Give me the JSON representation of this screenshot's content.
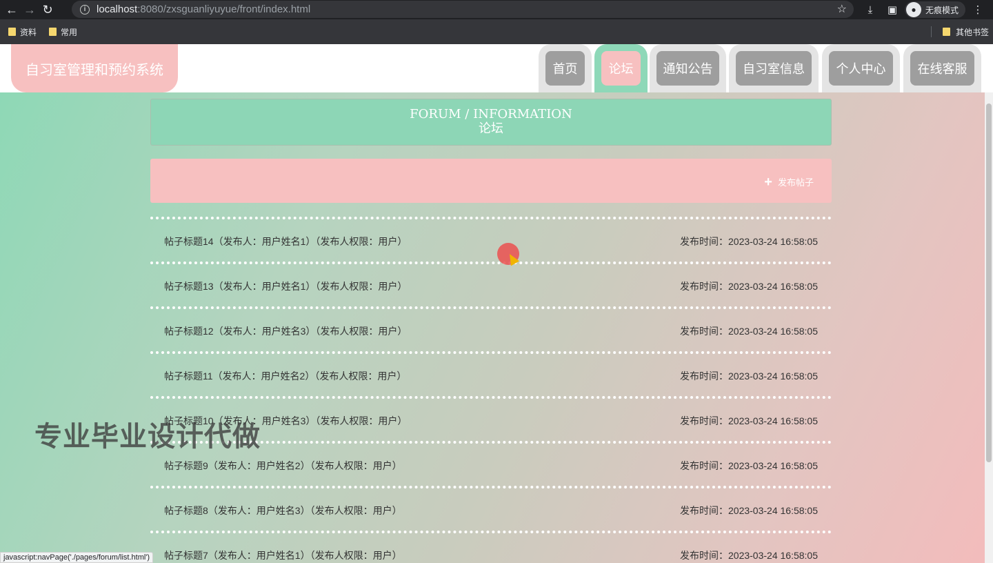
{
  "browser": {
    "url_host": "localhost",
    "url_rest": ":8080/zxsguanliyuyue/front/index.html",
    "incognito_label": "无痕模式",
    "bookmarks": [
      "资料",
      "常用"
    ],
    "other_bookmarks": "其他书签"
  },
  "site": {
    "logo": "自习室管理和预约系统",
    "nav": [
      "首页",
      "论坛",
      "通知公告",
      "自习室信息",
      "个人中心",
      "在线客服"
    ],
    "active_nav": "论坛"
  },
  "forum": {
    "title_en": "FORUM / INFORMATION",
    "title_cn": "论坛",
    "publish_label": "发布帖子",
    "posts": [
      {
        "title": "帖子标题14（发布人：用户姓名1）（发布人权限：用户）",
        "time": "发布时间：2023-03-24 16:58:05"
      },
      {
        "title": "帖子标题13（发布人：用户姓名1）（发布人权限：用户）",
        "time": "发布时间：2023-03-24 16:58:05"
      },
      {
        "title": "帖子标题12（发布人：用户姓名3）（发布人权限：用户）",
        "time": "发布时间：2023-03-24 16:58:05"
      },
      {
        "title": "帖子标题11（发布人：用户姓名2）（发布人权限：用户）",
        "time": "发布时间：2023-03-24 16:58:05"
      },
      {
        "title": "帖子标题10（发布人：用户姓名3）（发布人权限：用户）",
        "time": "发布时间：2023-03-24 16:58:05"
      },
      {
        "title": "帖子标题9（发布人：用户姓名2）（发布人权限：用户）",
        "time": "发布时间：2023-03-24 16:58:05"
      },
      {
        "title": "帖子标题8（发布人：用户姓名3）（发布人权限：用户）",
        "time": "发布时间：2023-03-24 16:58:05"
      },
      {
        "title": "帖子标题7（发布人：用户姓名1）（发布人权限：用户）",
        "time": "发布时间：2023-03-24 16:58:05"
      }
    ]
  },
  "overlay": {
    "watermark": "专业毕业设计代做",
    "status_url": "javascript:navPage('./pages/forum/list.html')"
  }
}
